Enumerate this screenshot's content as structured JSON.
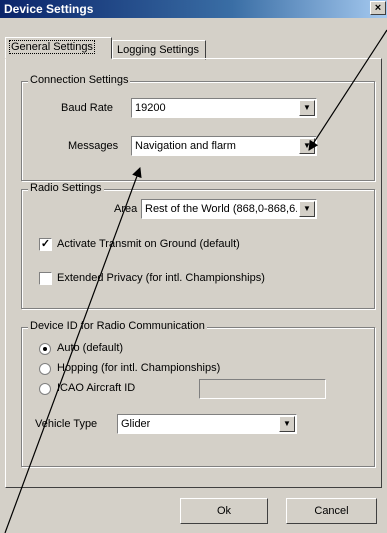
{
  "window": {
    "title": "Device Settings",
    "close_glyph": "×"
  },
  "tabs": [
    {
      "label": "General Settings",
      "selected": true
    },
    {
      "label": "Logging Settings",
      "selected": false
    }
  ],
  "connection": {
    "group_label": "Connection Settings",
    "baud_label": "Baud Rate",
    "baud_value": "19200",
    "messages_label": "Messages",
    "messages_value": "Navigation and flarm"
  },
  "radio": {
    "group_label": "Radio Settings",
    "area_label": "Area",
    "area_value": "Rest of the World (868,0-868,6...",
    "transmit_label": "Activate Transmit on Ground (default)",
    "transmit_checked": true,
    "privacy_label": "Extended Privacy (for intl. Championships)",
    "privacy_checked": false
  },
  "device_id": {
    "group_label": "Device ID for Radio Communication",
    "options": [
      {
        "label": "Auto (default)",
        "selected": true
      },
      {
        "label": "Hopping (for intl. Championships)",
        "selected": false
      },
      {
        "label": "ICAO Aircraft ID",
        "selected": false
      }
    ],
    "icao_value": "",
    "vehicle_label": "Vehicle Type",
    "vehicle_value": "Glider"
  },
  "buttons": {
    "ok": "Ok",
    "cancel": "Cancel"
  },
  "icons": {
    "dropdown": "▼",
    "check": "✓"
  }
}
